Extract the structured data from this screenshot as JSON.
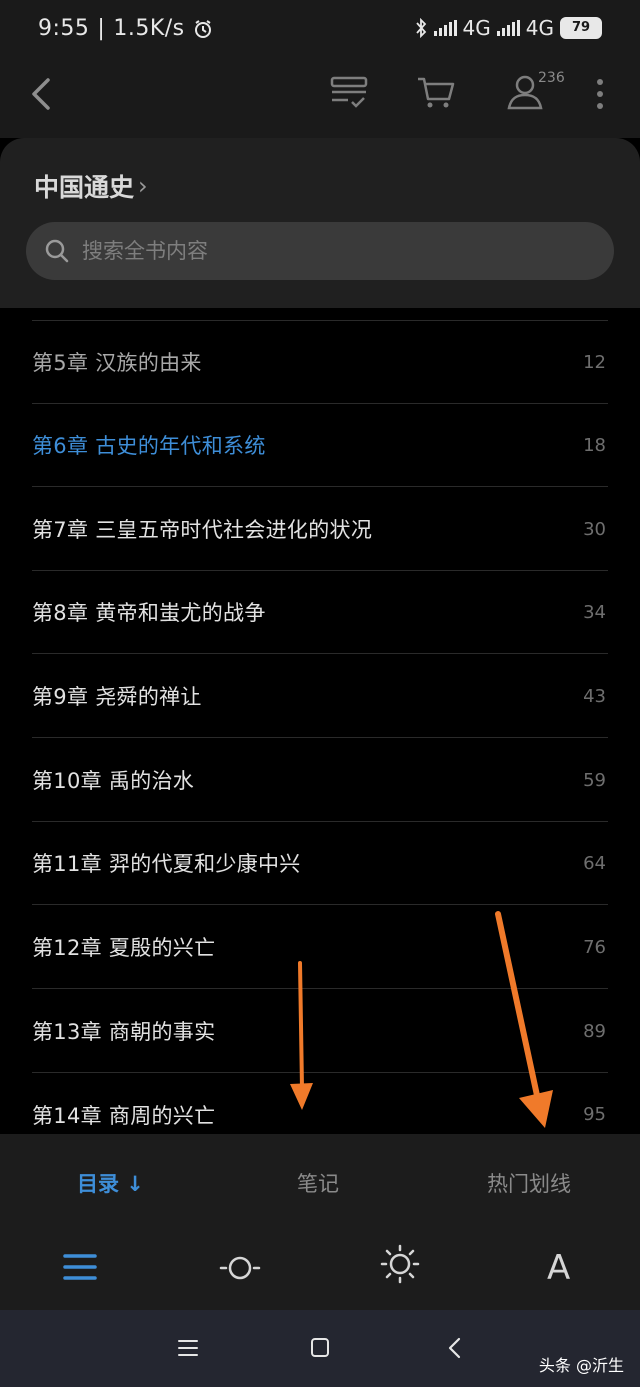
{
  "status_bar": {
    "time": "9:55",
    "net_speed": "1.5K/s",
    "net1": "4G",
    "net2": "4G",
    "battery": "79"
  },
  "toolbar": {
    "avatar_count": "236"
  },
  "book": {
    "title": "中国通史",
    "chevron": "›"
  },
  "search": {
    "placeholder": "搜索全书内容"
  },
  "chapters": [
    {
      "title": "第5章 汉族的由来",
      "page": "12"
    },
    {
      "title": "第6章 古史的年代和系统",
      "page": "18"
    },
    {
      "title": "第7章 三皇五帝时代社会进化的状况",
      "page": "30"
    },
    {
      "title": "第8章 黄帝和蚩尤的战争",
      "page": "34"
    },
    {
      "title": "第9章 尧舜的禅让",
      "page": "43"
    },
    {
      "title": "第10章 禹的治水",
      "page": "59"
    },
    {
      "title": "第11章 羿的代夏和少康中兴",
      "page": "64"
    },
    {
      "title": "第12章 夏殷的兴亡",
      "page": "76"
    },
    {
      "title": "第13章 商朝的事实",
      "page": "89"
    },
    {
      "title": "第14章 商周的兴亡",
      "page": "95"
    }
  ],
  "tabs": {
    "toc": "目录 ↓",
    "notes": "笔记",
    "hot": "热门划线"
  },
  "tools": {
    "font": "A"
  },
  "watermark": "头条 @沂生",
  "colors": {
    "accent": "#3e8ed8",
    "annotation": "#f07a2a"
  }
}
